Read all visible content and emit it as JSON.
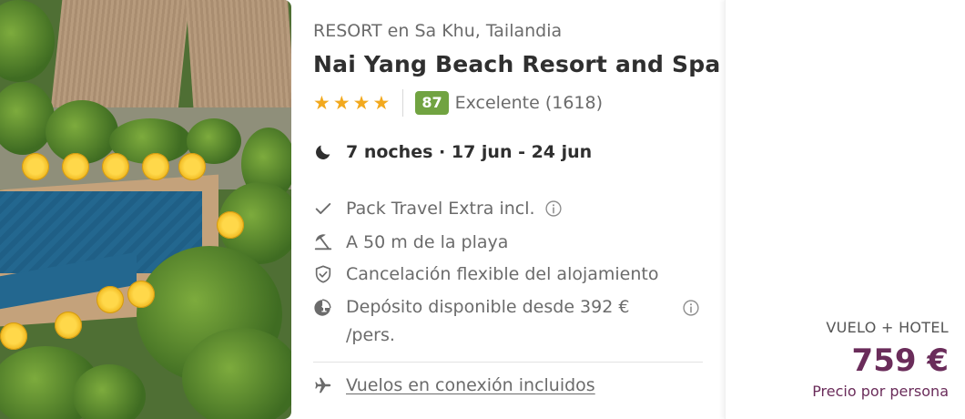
{
  "hotel": {
    "type_location": "RESORT en Sa Khu, Tailandia",
    "name": "Nai Yang Beach Resort and Spa",
    "stars": 4,
    "rating_score": "87",
    "rating_text": "Excelente (1618)",
    "image_alt_icon": "resort-aerial-photo"
  },
  "stay": {
    "nights_dates": "7 noches · 17 jun - 24 jun",
    "icon": "moon-icon"
  },
  "features": [
    {
      "icon": "check-icon",
      "text": "Pack Travel Extra incl.",
      "has_info": true
    },
    {
      "icon": "beach-umbrella-icon",
      "text": "A 50 m de la playa",
      "has_info": false
    },
    {
      "icon": "shield-check-icon",
      "text": "Cancelación flexible del alojamiento",
      "has_info": false
    },
    {
      "icon": "deposit-icon",
      "text_line1": "Depósito disponible desde 392 €",
      "text_line2": "/pers.",
      "has_info": true
    }
  ],
  "flights": {
    "icon": "plane-icon",
    "text": "Vuelos en conexión incluidos"
  },
  "price": {
    "package_label": "VUELO + HOTEL",
    "amount": "759 €",
    "per_person": "Precio por persona"
  },
  "colors": {
    "star": "#f2a91e",
    "score_badge": "#71a341",
    "price": "#6a2c5a",
    "text_muted": "#6b6b6b",
    "text_dark": "#2f2f2f"
  }
}
